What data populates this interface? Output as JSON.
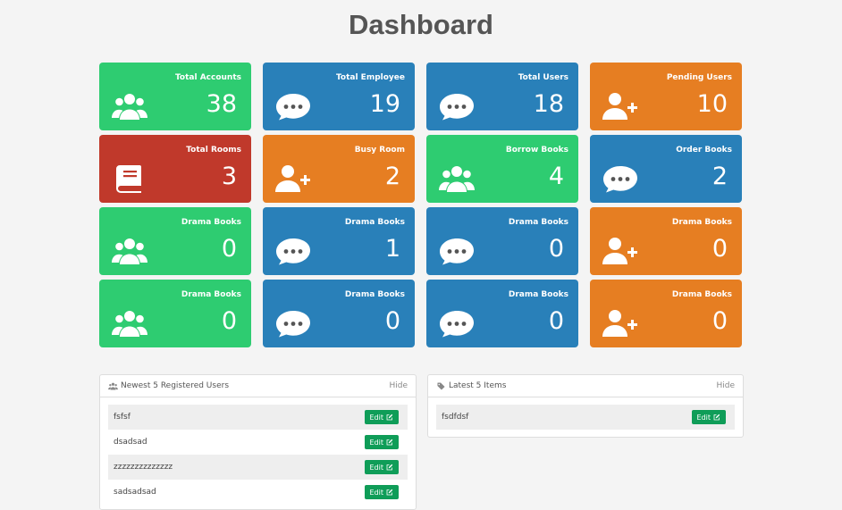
{
  "page": {
    "title": "Dashboard"
  },
  "colors": {
    "green": "#2ecc71",
    "blue": "#2980b9",
    "orange": "#e67e22",
    "red": "#c0392b",
    "edit": "#0f9d58"
  },
  "cards": [
    {
      "label": "Total Accounts",
      "value": "38",
      "color": "green",
      "icon": "users-icon"
    },
    {
      "label": "Total Employee",
      "value": "19",
      "color": "blue",
      "icon": "comment-icon"
    },
    {
      "label": "Total Users",
      "value": "18",
      "color": "blue",
      "icon": "comment-icon"
    },
    {
      "label": "Pending Users",
      "value": "10",
      "color": "orange",
      "icon": "user-plus-icon"
    },
    {
      "label": "Total Rooms",
      "value": "3",
      "color": "red",
      "icon": "book-icon"
    },
    {
      "label": "Busy Room",
      "value": "2",
      "color": "orange",
      "icon": "user-plus-icon"
    },
    {
      "label": "Borrow Books",
      "value": "4",
      "color": "green",
      "icon": "users-icon"
    },
    {
      "label": "Order Books",
      "value": "2",
      "color": "blue",
      "icon": "comment-icon"
    },
    {
      "label": "Drama Books",
      "value": "0",
      "color": "green",
      "icon": "users-icon"
    },
    {
      "label": "Drama Books",
      "value": "1",
      "color": "blue",
      "icon": "comment-icon"
    },
    {
      "label": "Drama Books",
      "value": "0",
      "color": "blue",
      "icon": "comment-icon"
    },
    {
      "label": "Drama Books",
      "value": "0",
      "color": "orange",
      "icon": "user-plus-icon"
    },
    {
      "label": "Drama Books",
      "value": "0",
      "color": "green",
      "icon": "users-icon"
    },
    {
      "label": "Drama Books",
      "value": "0",
      "color": "blue",
      "icon": "comment-icon"
    },
    {
      "label": "Drama Books",
      "value": "0",
      "color": "blue",
      "icon": "comment-icon"
    },
    {
      "label": "Drama Books",
      "value": "0",
      "color": "orange",
      "icon": "user-plus-icon"
    }
  ],
  "panels": {
    "users": {
      "title": "Newest 5 Registered Users",
      "icon": "users-icon",
      "hide_label": "Hide",
      "rows": [
        "fsfsf",
        "dsadsad",
        "zzzzzzzzzzzzzz",
        "sadsadsad"
      ],
      "edit_label": "Edit"
    },
    "items": {
      "title": "Latest 5 Items",
      "icon": "tag-icon",
      "hide_label": "Hide",
      "rows": [
        "fsdfdsf"
      ],
      "edit_label": "Edit"
    }
  }
}
